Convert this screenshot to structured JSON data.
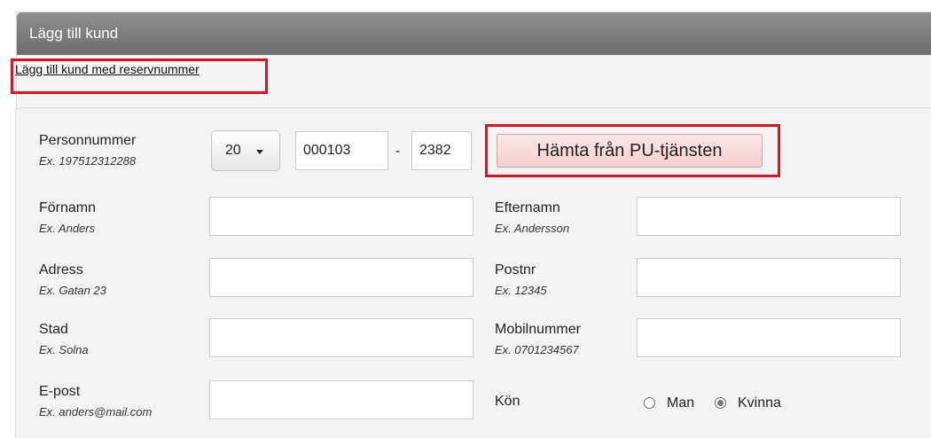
{
  "panel": {
    "title": "Lägg till kund"
  },
  "reserve_link": "Lägg till kund med reservnummer",
  "personnummer": {
    "label": "Personnummer",
    "example": "Ex. 197512312288",
    "century": "20",
    "date_part": "000103",
    "dash": "-",
    "last_four": "2382",
    "fetch_button": "Hämta från PU-tjänsten"
  },
  "fields": {
    "fornamn": {
      "label": "Förnamn",
      "example": "Ex. Anders",
      "value": ""
    },
    "efternamn": {
      "label": "Efternamn",
      "example": "Ex. Andersson",
      "value": ""
    },
    "adress": {
      "label": "Adress",
      "example": "Ex. Gatan 23",
      "value": ""
    },
    "postnr": {
      "label": "Postnr",
      "example": "Ex. 12345",
      "value": ""
    },
    "stad": {
      "label": "Stad",
      "example": "Ex. Solna",
      "value": ""
    },
    "mobil": {
      "label": "Mobilnummer",
      "example": "Ex. 0701234567",
      "value": ""
    },
    "epost": {
      "label": "E-post",
      "example": "Ex. anders@mail.com",
      "value": ""
    }
  },
  "gender": {
    "label": "Kön",
    "options": [
      "Man",
      "Kvinna"
    ],
    "selected": "Kvinna"
  },
  "colors": {
    "highlight": "#e0101b",
    "header": "#7a7a7a",
    "button": "#f5cfcf"
  }
}
